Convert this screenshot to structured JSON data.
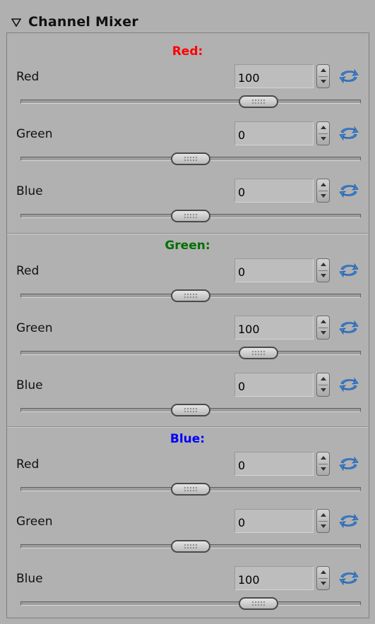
{
  "panel": {
    "title": "Channel Mixer",
    "collapse_icon": "triangle-down-icon"
  },
  "colors": {
    "red": "#ff0000",
    "green": "#007000",
    "blue": "#0000ff",
    "reset_icon": "#2f7fd8"
  },
  "groups": [
    {
      "title": "Red:",
      "color": "#ff0000",
      "rows": [
        {
          "label": "Red",
          "value": "100",
          "slider_fraction": 0.7
        },
        {
          "label": "Green",
          "value": "0",
          "slider_fraction": 0.5
        },
        {
          "label": "Blue",
          "value": "0",
          "slider_fraction": 0.5
        }
      ]
    },
    {
      "title": "Green:",
      "color": "#007000",
      "rows": [
        {
          "label": "Red",
          "value": "0",
          "slider_fraction": 0.5
        },
        {
          "label": "Green",
          "value": "100",
          "slider_fraction": 0.7
        },
        {
          "label": "Blue",
          "value": "0",
          "slider_fraction": 0.5
        }
      ]
    },
    {
      "title": "Blue:",
      "color": "#0000ff",
      "rows": [
        {
          "label": "Red",
          "value": "0",
          "slider_fraction": 0.5
        },
        {
          "label": "Green",
          "value": "0",
          "slider_fraction": 0.5
        },
        {
          "label": "Blue",
          "value": "100",
          "slider_fraction": 0.7
        }
      ]
    }
  ]
}
